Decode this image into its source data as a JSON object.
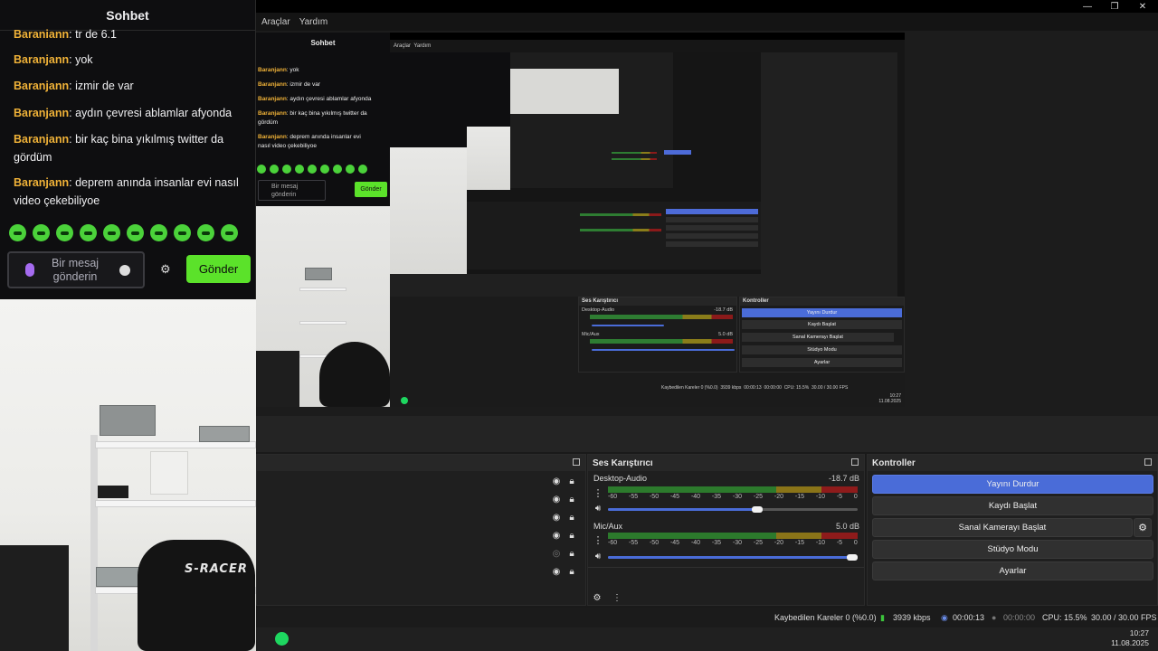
{
  "chat": {
    "title": "Sohbet",
    "messages": [
      {
        "user": "Baranjann",
        "text": ": tr de 6.1"
      },
      {
        "user": "Baranjann",
        "text": ": yok"
      },
      {
        "user": "Baranjann",
        "text": ": izmir de var"
      },
      {
        "user": "Baranjann",
        "text": ": aydın çevresi ablamlar afyonda"
      },
      {
        "user": "Baranjann",
        "text": ": bir kaç bina yıkılmış twitter da gördüm"
      },
      {
        "user": "Baranjann",
        "text": ": deprem anında insanlar evi nasıl video çekebiliyoe"
      }
    ],
    "input_placeholder": "Bir mesaj gönderin",
    "send_label": "Gönder",
    "settings_icon": "gear-icon"
  },
  "menu": {
    "items": [
      "Araçlar",
      "Yardım"
    ]
  },
  "window_controls": [
    "minimize",
    "maximize",
    "close"
  ],
  "webcam": {
    "chair_brand": "S-RACER"
  },
  "mixer": {
    "title": "Ses Karıştırıcı",
    "ticks": [
      "-60",
      "-55",
      "-50",
      "-45",
      "-40",
      "-35",
      "-30",
      "-25",
      "-20",
      "-15",
      "-10",
      "-5",
      "0"
    ],
    "channels": [
      {
        "name": "Desktop-Audio",
        "db": "-18.7 dB",
        "volume": 0.62
      },
      {
        "name": "Mic/Aux",
        "db": "5.0 dB",
        "volume": 1.0
      }
    ]
  },
  "controls": {
    "title": "Kontroller",
    "stop_stream": "Yayını Durdur",
    "start_recording": "Kaydı Başlat",
    "start_virtual_cam": "Sanal Kamerayı Başlat",
    "studio_mode": "Stüdyo Modu",
    "settings": "Ayarlar"
  },
  "status": {
    "dropped_frames": "Kaybedilen Kareler 0 (%0.0)",
    "bitrate": "3939 kbps",
    "stream_time": "00:00:13",
    "record_time": "00:00:00",
    "cpu": "CPU: 15.5%",
    "fps": "30.00 / 30.00 FPS"
  },
  "taskbar": {
    "time": "10:27",
    "date": "11.08.2025"
  },
  "mini": {
    "chat_title": "Sohbet",
    "messages": [
      "yok",
      "izmir de var",
      "aydın çevresi ablamlar afyonda",
      "bir kaç bina yıkılmış twitter da",
      "gördüm",
      "deprem anında insanlar evi",
      "nasıl video çekebiliyoe"
    ],
    "user": "Baranjann",
    "input_placeholder_1": "Bir mesaj",
    "input_placeholder_2": "gönderin",
    "send_label": "Gönder",
    "menu_1": "Araçlar",
    "menu_2": "Yardım",
    "mixer_title": "Ses Karıştırıcı",
    "controls_title": "Kontroller",
    "stop_stream": "Yayını Durdur",
    "start_recording": "Kaydı Başlat",
    "start_virtual_cam": "Sanal Kamerayı Başlat",
    "studio_mode": "Stüdyo Modu",
    "settings": "Ayarlar",
    "ch1": "Desktop-Audio",
    "ch1_db": "-18.7 dB",
    "ch2": "Mic/Aux",
    "ch2_db": "5.0 dB",
    "dropped": "Kaybedilen Kareler 0 (%0.0)",
    "bitrate": "3939 kbps",
    "stream_time": "00:00:13",
    "record_time": "00:00:00",
    "cpu": "CPU: 15.5%",
    "fps": "30.00 / 30.00 FPS",
    "time": "10:27",
    "date": "11.08.2025"
  }
}
